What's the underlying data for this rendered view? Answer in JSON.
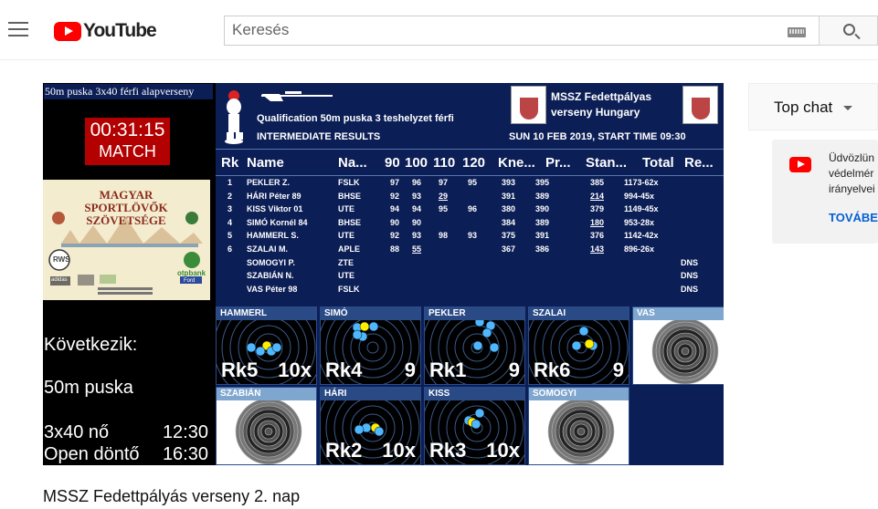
{
  "header": {
    "logo_text": "YouTube",
    "search_placeholder": "Keresés"
  },
  "video": {
    "competition_title": "50m puska 3x40 férfi alapverseny",
    "timer": "00:31:15",
    "phase": "MATCH",
    "sponsor_title": "MAGYAR SPORTLÖVŐK SZÖVETSÉGE",
    "sponsor_logos": [
      "RWS",
      "otpbank",
      "Ford",
      "adidas"
    ],
    "next_label": "Következik:",
    "next_event": "50m puska",
    "schedule": [
      {
        "event": "3x40 nő",
        "time": "12:30"
      },
      {
        "event": "Open döntő",
        "time": "16:30"
      }
    ],
    "results": {
      "heading": "Qualification 50m puska 3 teshelyzet férfi",
      "subheading": "INTERMEDIATE RESULTS",
      "organizer_line1": "MSSZ Fedettpályas",
      "organizer_line2": "verseny Hungary",
      "date_line": "SUN 10 FEB 2019, START TIME 09:30",
      "columns": [
        "Rk",
        "Name",
        "Na...",
        "90",
        "100",
        "110",
        "120",
        "Kne...",
        "Pr...",
        "Stan...",
        "Total",
        "Re..."
      ],
      "rows": [
        {
          "rk": "1",
          "name": "PEKLER Z.",
          "nat": "FSLK",
          "s90": "97",
          "s100": "96",
          "s110": "97",
          "s120": "95",
          "kne": "393",
          "pr": "395",
          "stan": "385",
          "stan_u": false,
          "total": "1173-62x",
          "re": "",
          "u100": false
        },
        {
          "rk": "2",
          "name": "HÁRI Péter 89",
          "nat": "BHSE",
          "s90": "92",
          "s100": "93",
          "s110": "29",
          "s120": "",
          "kne": "391",
          "pr": "389",
          "stan": "214",
          "stan_u": true,
          "total": "994-45x",
          "re": "",
          "u110": true
        },
        {
          "rk": "3",
          "name": "KISS Viktor 01",
          "nat": "UTE",
          "s90": "94",
          "s100": "94",
          "s110": "95",
          "s120": "96",
          "kne": "380",
          "pr": "390",
          "stan": "379",
          "stan_u": false,
          "total": "1149-45x",
          "re": ""
        },
        {
          "rk": "4",
          "name": "SIMÓ Kornél 84",
          "nat": "BHSE",
          "s90": "90",
          "s100": "90",
          "s110": "",
          "s120": "",
          "kne": "384",
          "pr": "389",
          "stan": "180",
          "stan_u": true,
          "total": "953-28x",
          "re": ""
        },
        {
          "rk": "5",
          "name": "HAMMERL S.",
          "nat": "UTE",
          "s90": "92",
          "s100": "93",
          "s110": "98",
          "s120": "93",
          "kne": "375",
          "pr": "391",
          "stan": "376",
          "stan_u": false,
          "total": "1142-42x",
          "re": ""
        },
        {
          "rk": "6",
          "name": "SZALAI M.",
          "nat": "APLE",
          "s90": "88",
          "s100": "55",
          "s110": "",
          "s120": "",
          "kne": "367",
          "pr": "386",
          "stan": "143",
          "stan_u": true,
          "total": "896-26x",
          "re": "",
          "u100": true
        },
        {
          "rk": "",
          "name": "SOMOGYI P.",
          "nat": "ZTE",
          "s90": "",
          "s100": "",
          "s110": "",
          "s120": "",
          "kne": "",
          "pr": "",
          "stan": "",
          "stan_u": false,
          "total": "",
          "re": "DNS"
        },
        {
          "rk": "",
          "name": "SZABIÁN N.",
          "nat": "UTE",
          "s90": "",
          "s100": "",
          "s110": "",
          "s120": "",
          "kne": "",
          "pr": "",
          "stan": "",
          "stan_u": false,
          "total": "",
          "re": "DNS"
        },
        {
          "rk": "",
          "name": "VAS Péter 98",
          "nat": "FSLK",
          "s90": "",
          "s100": "",
          "s110": "",
          "s120": "",
          "kne": "",
          "pr": "",
          "stan": "",
          "stan_u": false,
          "total": "",
          "re": "DNS"
        }
      ]
    },
    "targets": [
      {
        "name": "HAMMERL",
        "rank": "Rk5",
        "score": "10x",
        "active": true
      },
      {
        "name": "SIMÓ",
        "rank": "Rk4",
        "score": "9",
        "active": true
      },
      {
        "name": "PEKLER",
        "rank": "Rk1",
        "score": "9",
        "active": true
      },
      {
        "name": "SZALAI",
        "rank": "Rk6",
        "score": "9",
        "active": true
      },
      {
        "name": "VAS",
        "rank": "",
        "score": "",
        "active": false
      },
      {
        "name": "SZABIÁN",
        "rank": "",
        "score": "",
        "active": false
      },
      {
        "name": "HÁRI",
        "rank": "Rk2",
        "score": "10x",
        "active": true
      },
      {
        "name": "KISS",
        "rank": "Rk3",
        "score": "10x",
        "active": true
      },
      {
        "name": "SOMOGYI",
        "rank": "",
        "score": "",
        "active": false
      }
    ]
  },
  "video_title": "MSSZ Fedettpályás verseny 2. nap",
  "chat": {
    "label": "Top chat",
    "notice_lines": [
      "Üdvözlün",
      "védelmér",
      "irányelvei"
    ],
    "more_label": "TOVÁBE"
  },
  "colors": {
    "brand_red": "#ff0000",
    "board_blue": "#0c1e56",
    "link_blue": "#065fd4"
  }
}
